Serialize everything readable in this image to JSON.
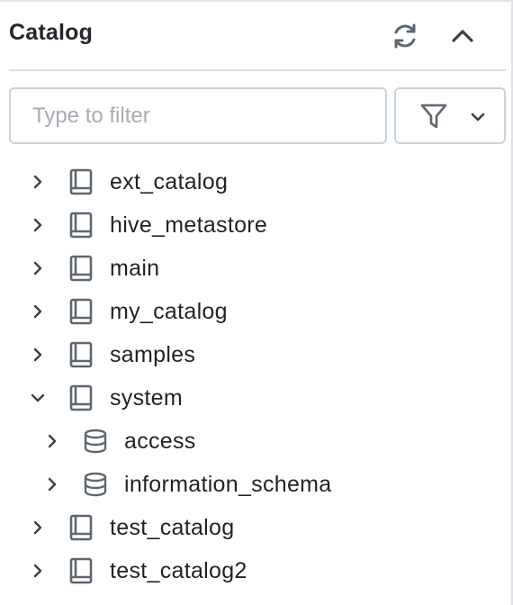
{
  "panel": {
    "title": "Catalog",
    "refresh_icon": "refresh-icon",
    "collapse_icon": "chevron-up-icon"
  },
  "filter": {
    "placeholder": "Type to filter",
    "value": "",
    "dropdown_icon": "funnel-icon"
  },
  "tree": {
    "items": [
      {
        "label": "ext_catalog",
        "level": 0,
        "expanded": false,
        "icon": "catalog-book-icon"
      },
      {
        "label": "hive_metastore",
        "level": 0,
        "expanded": false,
        "icon": "catalog-book-icon"
      },
      {
        "label": "main",
        "level": 0,
        "expanded": false,
        "icon": "catalog-book-icon"
      },
      {
        "label": "my_catalog",
        "level": 0,
        "expanded": false,
        "icon": "catalog-book-icon"
      },
      {
        "label": "samples",
        "level": 0,
        "expanded": false,
        "icon": "catalog-book-icon"
      },
      {
        "label": "system",
        "level": 0,
        "expanded": true,
        "icon": "catalog-book-icon"
      },
      {
        "label": "access",
        "level": 1,
        "expanded": false,
        "icon": "database-icon"
      },
      {
        "label": "information_schema",
        "level": 1,
        "expanded": false,
        "icon": "database-icon"
      },
      {
        "label": "test_catalog",
        "level": 0,
        "expanded": false,
        "icon": "catalog-book-icon"
      },
      {
        "label": "test_catalog2",
        "level": 0,
        "expanded": false,
        "icon": "catalog-book-icon"
      }
    ]
  },
  "colors": {
    "text": "#1f2328",
    "icon": "#5f6770",
    "border": "#c9d3dd",
    "divider": "#dcdfe3",
    "placeholder": "#a7adb3"
  }
}
